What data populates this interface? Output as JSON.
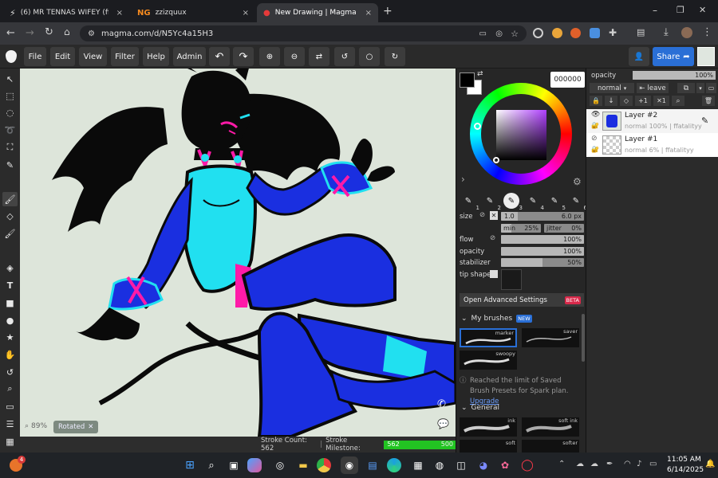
{
  "tabs": [
    {
      "title": "(6) MR TENNAS WIFEY (ffatality",
      "close": "×"
    },
    {
      "title": "zzizquux",
      "close": "×"
    },
    {
      "title": "New Drawing | Magma",
      "close": "×"
    }
  ],
  "new_tab": "+",
  "window_controls": {
    "min": "–",
    "max": "❐",
    "close": "✕"
  },
  "address": {
    "url": "magma.com/d/N5Yc4a15H3"
  },
  "menu": {
    "file": "File",
    "edit": "Edit",
    "view": "View",
    "filter": "Filter",
    "help": "Help",
    "admin": "Admin"
  },
  "share_label": "Share",
  "canvas": {
    "zoom": "89%",
    "rotated": "Rotated",
    "stroke_count_label": "Stroke Count: 562",
    "milestone_label": "Stroke Milestone:",
    "milestone_value": "562",
    "milestone_max": "500",
    "milestone_progress": 1.0
  },
  "color": {
    "hex": "000000",
    "primary": "#000000",
    "secondary": "#ffffff"
  },
  "brushes": {
    "slots": [
      "1",
      "2",
      "3",
      "4",
      "5",
      "6"
    ],
    "selected": 3
  },
  "brush_settings": {
    "size_label": "size",
    "size_value": "1.0",
    "size_px": "6.0 px",
    "min_label": "min",
    "min_value": "25%",
    "jitter_label": "jitter",
    "jitter_value": "0%",
    "flow_label": "flow",
    "flow_value": "100%",
    "opacity_label": "opacity",
    "opacity_value": "100%",
    "stabilizer_label": "stabilizer",
    "stabilizer_value": "50%",
    "tip_label": "tip shape"
  },
  "advanced_label": "Open Advanced Settings",
  "beta_badge": "BETA",
  "my_brushes": {
    "title": "My brushes",
    "badge": "NEW",
    "items": [
      "marker",
      "saver",
      "swoopy"
    ]
  },
  "limit_note": "Reached the limit of Saved Brush Presets for Spark plan.",
  "upgrade": "Upgrade",
  "general": {
    "title": "General",
    "items": [
      "ink",
      "soft ink",
      "soft",
      "softer"
    ]
  },
  "layers_panel": {
    "opacity_label": "opacity",
    "opacity_value": "100%",
    "blend": "normal",
    "leave": "leave",
    "layers": [
      {
        "name": "Layer #2",
        "meta": "normal 100% | ffatalityy"
      },
      {
        "name": "Layer #1",
        "meta": "normal 6% | ffatalityy"
      }
    ]
  },
  "taskbar": {
    "notification_count": "4",
    "time": "11:05 AM",
    "date": "6/14/2025"
  },
  "colors": {
    "accent": "#2a6fd6",
    "canvas_bg": "#dde5da",
    "char_blue": "#1a2fe0",
    "char_cyan": "#21e0f0",
    "char_pink": "#ff1aa8"
  }
}
